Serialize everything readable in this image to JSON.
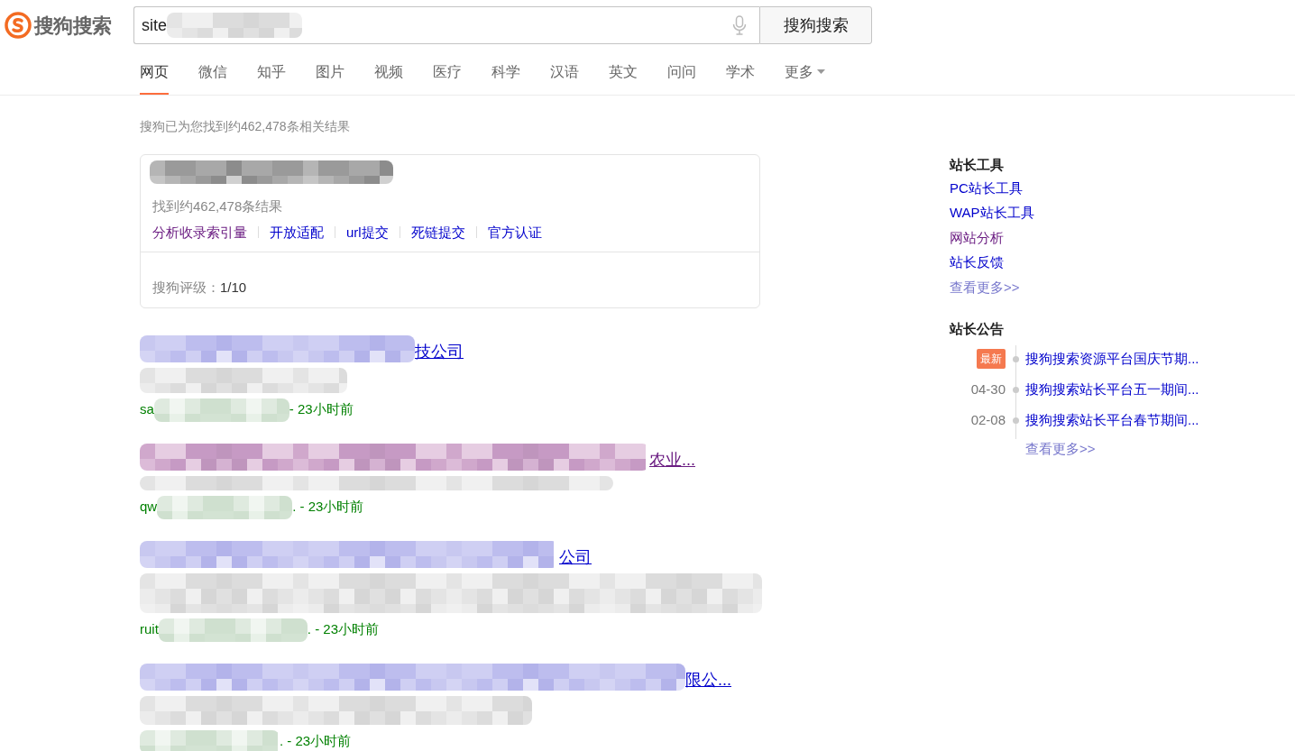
{
  "logo": {
    "text": "搜狗搜索"
  },
  "search": {
    "value": "site",
    "button": "搜狗搜索"
  },
  "tabs": [
    {
      "label": "网页",
      "selected": true
    },
    {
      "label": "微信",
      "selected": false
    },
    {
      "label": "知乎",
      "selected": false
    },
    {
      "label": "图片",
      "selected": false
    },
    {
      "label": "视频",
      "selected": false
    },
    {
      "label": "医疗",
      "selected": false
    },
    {
      "label": "科学",
      "selected": false
    },
    {
      "label": "汉语",
      "selected": false
    },
    {
      "label": "英文",
      "selected": false
    },
    {
      "label": "问问",
      "selected": false
    },
    {
      "label": "学术",
      "selected": false
    },
    {
      "label": "更多",
      "selected": false,
      "dropdown": true
    }
  ],
  "result_count": "搜狗已为您找到约462,478条相关结果",
  "site_card": {
    "found": "找到约462,478条结果",
    "links": [
      {
        "label": "分析收录索引量",
        "visited": true
      },
      {
        "label": "开放适配",
        "visited": false
      },
      {
        "label": "url提交",
        "visited": false
      },
      {
        "label": "死链提交",
        "visited": false
      },
      {
        "label": "官方认证",
        "visited": false
      }
    ],
    "rating_label": "搜狗评级：",
    "rating": "1/10"
  },
  "results": [
    {
      "title_tail": "技公司",
      "visited": false,
      "url_prefix": "sa",
      "time": "- 23小时前"
    },
    {
      "title_tail": "农业...",
      "visited": true,
      "url_prefix": "qw",
      "time": ". - 23小时前"
    },
    {
      "title_tail": "公司",
      "visited": false,
      "url_prefix": "ruit",
      "time": ". - 23小时前"
    },
    {
      "title_tail": "限公...",
      "visited": false,
      "time": ". - 23小时前"
    }
  ],
  "sidebar": {
    "tools_title": "站长工具",
    "tools": [
      {
        "label": "PC站长工具",
        "visited": false
      },
      {
        "label": "WAP站长工具",
        "visited": false
      },
      {
        "label": "网站分析",
        "visited": true
      },
      {
        "label": "站长反馈",
        "visited": false
      }
    ],
    "tools_more": "查看更多>>",
    "notices_title": "站长公告",
    "notices": [
      {
        "tag": "最新",
        "kind": "badge",
        "title": "搜狗搜索资源平台国庆节期..."
      },
      {
        "tag": "04-30",
        "kind": "date",
        "title": "搜狗搜索站长平台五一期间..."
      },
      {
        "tag": "02-08",
        "kind": "date",
        "title": "搜狗搜索站长平台春节期间..."
      }
    ],
    "notices_more": "查看更多>>"
  }
}
